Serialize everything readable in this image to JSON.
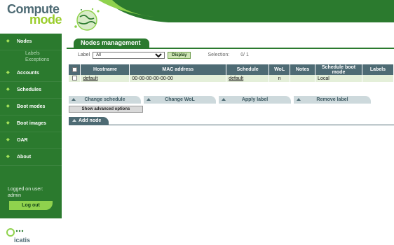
{
  "brand": {
    "line1": "Compute",
    "line2": "mode"
  },
  "sidebar": {
    "items": [
      {
        "label": "Nodes",
        "sub": [
          "Labels",
          "Exceptions"
        ]
      },
      {
        "label": "Accounts"
      },
      {
        "label": "Schedules"
      },
      {
        "label": "Boot modes"
      },
      {
        "label": "Boot images"
      },
      {
        "label": "OAR"
      },
      {
        "label": "About"
      }
    ],
    "logged_on_label": "Logged on user:",
    "user": "admin",
    "logout_label": "Log out"
  },
  "footer_logo": "icatis",
  "main": {
    "title": "Nodes management",
    "filter": {
      "label": "Label",
      "selected": "All",
      "display_button": "Display",
      "selection_label": "Selection:",
      "selection_value": "0/ 1"
    },
    "table": {
      "headers": [
        "Hostname",
        "MAC address",
        "Schedule",
        "WoL",
        "Notes",
        "Schedule boot mode",
        "Labels"
      ],
      "rows": [
        {
          "hostname": "default",
          "mac": "00-00-00-00-00-00",
          "schedule": "default",
          "wol": "n",
          "notes": "",
          "boot_mode": "Local",
          "labels": ""
        }
      ]
    },
    "actions": [
      "Change schedule",
      "Change WoL",
      "Apply label",
      "Remove label"
    ],
    "advanced_button": "Show advanced options",
    "add_node": "Add node"
  },
  "colors": {
    "green": "#2b7a2e",
    "slate": "#4e6b74",
    "lime": "#8fd24d",
    "row_bg": "#e4efd9"
  }
}
